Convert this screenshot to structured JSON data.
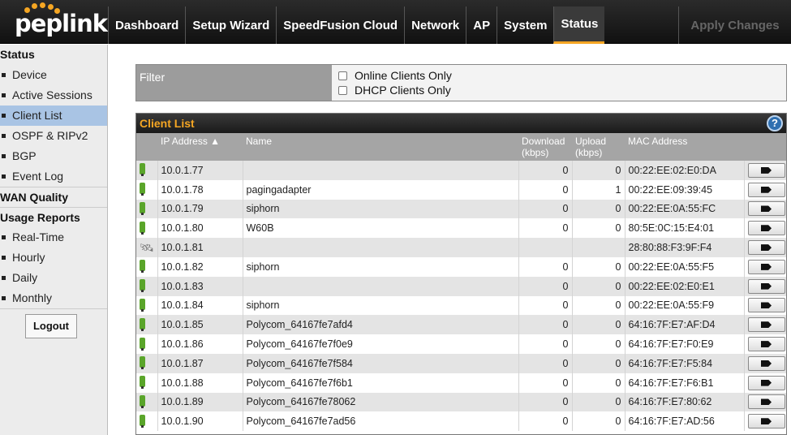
{
  "brand": {
    "name": "peplink",
    "accent": "#f5a623"
  },
  "nav": {
    "items": [
      "Dashboard",
      "Setup Wizard",
      "SpeedFusion Cloud",
      "Network",
      "AP",
      "System",
      "Status"
    ],
    "active": "Status",
    "apply": "Apply Changes"
  },
  "sidebar": {
    "status_header": "Status",
    "status_items": [
      "Device",
      "Active Sessions",
      "Client List",
      "OSPF & RIPv2",
      "BGP",
      "Event Log"
    ],
    "active_item": "Client List",
    "wan_header": "WAN Quality",
    "usage_header": "Usage Reports",
    "usage_items": [
      "Real-Time",
      "Hourly",
      "Daily",
      "Monthly"
    ],
    "logout": "Logout"
  },
  "filter": {
    "label": "Filter",
    "online_only": "Online Clients Only",
    "dhcp_only": "DHCP Clients Only"
  },
  "client_list": {
    "title": "Client List",
    "help": "?",
    "columns": {
      "ip": "IP Address ▲",
      "name": "Name",
      "download": "Download (kbps)",
      "upload": "Upload (kbps)",
      "mac": "MAC Address"
    },
    "rows": [
      {
        "icon": "wired",
        "ip": "10.0.1.77",
        "name": "",
        "download": "0",
        "upload": "0",
        "mac": "00:22:EE:02:E0:DA"
      },
      {
        "icon": "wired",
        "ip": "10.0.1.78",
        "name": "pagingadapter",
        "download": "0",
        "upload": "1",
        "mac": "00:22:EE:09:39:45"
      },
      {
        "icon": "wired",
        "ip": "10.0.1.79",
        "name": "siphorn",
        "download": "0",
        "upload": "0",
        "mac": "00:22:EE:0A:55:FC"
      },
      {
        "icon": "wired",
        "ip": "10.0.1.80",
        "name": "W60B",
        "download": "0",
        "upload": "0",
        "mac": "80:5E:0C:15:E4:01"
      },
      {
        "icon": "offline",
        "ip": "10.0.1.81",
        "name": "",
        "download": "",
        "upload": "",
        "mac": "28:80:88:F3:9F:F4"
      },
      {
        "icon": "wired",
        "ip": "10.0.1.82",
        "name": "siphorn",
        "download": "0",
        "upload": "0",
        "mac": "00:22:EE:0A:55:F5"
      },
      {
        "icon": "wired",
        "ip": "10.0.1.83",
        "name": "",
        "download": "0",
        "upload": "0",
        "mac": "00:22:EE:02:E0:E1"
      },
      {
        "icon": "wired",
        "ip": "10.0.1.84",
        "name": "siphorn",
        "download": "0",
        "upload": "0",
        "mac": "00:22:EE:0A:55:F9"
      },
      {
        "icon": "wired",
        "ip": "10.0.1.85",
        "name": "Polycom_64167fe7afd4",
        "download": "0",
        "upload": "0",
        "mac": "64:16:7F:E7:AF:D4"
      },
      {
        "icon": "wired",
        "ip": "10.0.1.86",
        "name": "Polycom_64167fe7f0e9",
        "download": "0",
        "upload": "0",
        "mac": "64:16:7F:E7:F0:E9"
      },
      {
        "icon": "wired",
        "ip": "10.0.1.87",
        "name": "Polycom_64167fe7f584",
        "download": "0",
        "upload": "0",
        "mac": "64:16:7F:E7:F5:84"
      },
      {
        "icon": "wired",
        "ip": "10.0.1.88",
        "name": "Polycom_64167fe7f6b1",
        "download": "0",
        "upload": "0",
        "mac": "64:16:7F:E7:F6:B1"
      },
      {
        "icon": "wired",
        "ip": "10.0.1.89",
        "name": "Polycom_64167fe78062",
        "download": "0",
        "upload": "0",
        "mac": "64:16:7F:E7:80:62"
      },
      {
        "icon": "wired",
        "ip": "10.0.1.90",
        "name": "Polycom_64167fe7ad56",
        "download": "0",
        "upload": "0",
        "mac": "64:16:7F:E7:AD:56"
      }
    ]
  }
}
